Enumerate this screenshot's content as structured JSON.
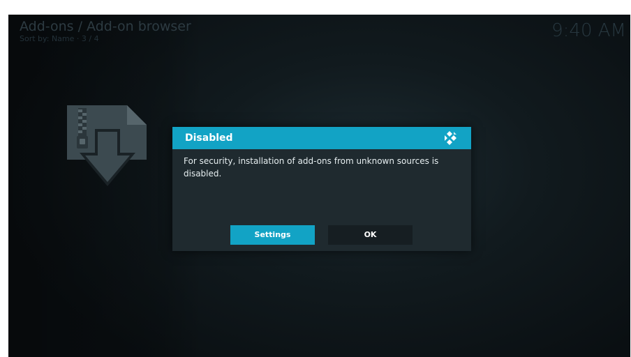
{
  "header": {
    "breadcrumb": "Add-ons / Add-on browser",
    "sort_info": "Sort by: Name  ·  3 / 4",
    "clock": "9:40 AM"
  },
  "addon_icon": {
    "icon": "zip-download-icon"
  },
  "dialog": {
    "title": "Disabled",
    "logo_icon": "kodi-logo-icon",
    "message": "For security, installation of add-ons from unknown sources is disabled.",
    "buttons": {
      "settings": "Settings",
      "ok": "OK"
    }
  },
  "colors": {
    "accent": "#12a3c5",
    "dialog_background": "#1f2a2f",
    "secondary_button": "#161e22"
  }
}
